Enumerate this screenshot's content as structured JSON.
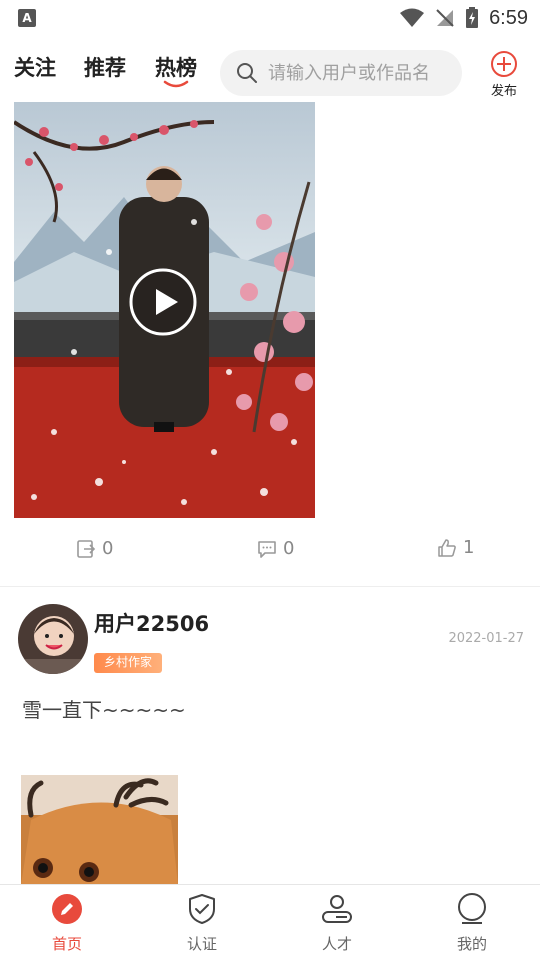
{
  "status_bar": {
    "time": "6:59",
    "notification_icon_letter": "A"
  },
  "top_nav": {
    "tabs": [
      {
        "label": "关注",
        "active": false
      },
      {
        "label": "推荐",
        "active": false
      },
      {
        "label": "热榜",
        "active": true
      }
    ],
    "search": {
      "placeholder": "请输入用户或作品名"
    },
    "publish_label": "发布"
  },
  "feed_item_video": {
    "actions": {
      "share_count": "0",
      "comment_count": "0",
      "like_count": "1"
    }
  },
  "post": {
    "username": "用户22506",
    "badge": "乡村作家",
    "date": "2022-01-27",
    "text": "雪一直下~~~~~"
  },
  "bottom_nav": {
    "items": [
      {
        "label": "首页",
        "icon": "pen-icon",
        "active": true
      },
      {
        "label": "认证",
        "icon": "shield-check-icon",
        "active": false
      },
      {
        "label": "人才",
        "icon": "person-icon",
        "active": false
      },
      {
        "label": "我的",
        "icon": "profile-circle-icon",
        "active": false
      }
    ]
  },
  "colors": {
    "accent": "#e84a3c",
    "badge_orange": "#ff8a4c",
    "muted": "#888888"
  }
}
